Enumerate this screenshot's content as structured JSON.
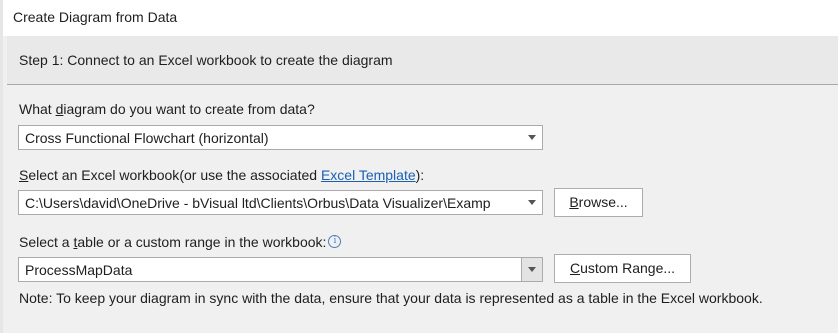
{
  "window": {
    "title": "Create Diagram from Data"
  },
  "step": {
    "heading": "Step 1: Connect to an Excel workbook to create the diagram"
  },
  "diagram_type": {
    "label_pre": "What ",
    "label_accel": "d",
    "label_post": "iagram do you want to create from data?",
    "selected": "Cross Functional Flowchart (horizontal)"
  },
  "workbook": {
    "label_accel": "S",
    "label_post": "elect an Excel workbook",
    "label_paren_open": "(or use the associated ",
    "template_link": "Excel Template",
    "label_paren_close": "):",
    "path": "C:\\Users\\david\\OneDrive - bVisual ltd\\Clients\\Orbus\\Data Visualizer\\Examp",
    "browse_accel": "B",
    "browse_rest": "rowse..."
  },
  "table": {
    "label_pre": "Select a ",
    "label_accel": "t",
    "label_post": "able or a custom range in the workbook:",
    "info_glyph": "i",
    "selected": "ProcessMapData",
    "custom_accel": "C",
    "custom_rest": "ustom Range..."
  },
  "note": "Note: To keep your diagram in sync with the data, ensure that your data is represented as a table in the Excel workbook."
}
